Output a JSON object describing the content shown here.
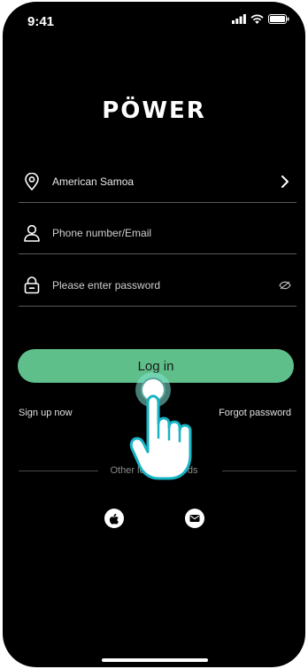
{
  "status_bar": {
    "time": "9:41"
  },
  "app": {
    "logo_text": "PÖWER"
  },
  "form": {
    "country": {
      "value": "American Samoa",
      "icon": "location-pin-icon"
    },
    "account": {
      "placeholder": "Phone number/Email",
      "icon": "user-icon"
    },
    "password": {
      "placeholder": "Please enter password",
      "icon": "lock-icon",
      "toggle_icon": "eye-off-icon"
    }
  },
  "actions": {
    "login_label": "Log in",
    "signup_label": "Sign up now",
    "forgot_label": "Forgot password"
  },
  "other_login": {
    "label": "Other login methods",
    "methods": [
      "apple-icon",
      "mail-icon"
    ]
  },
  "colors": {
    "accent": "#5fbf8a",
    "background": "#000000"
  }
}
